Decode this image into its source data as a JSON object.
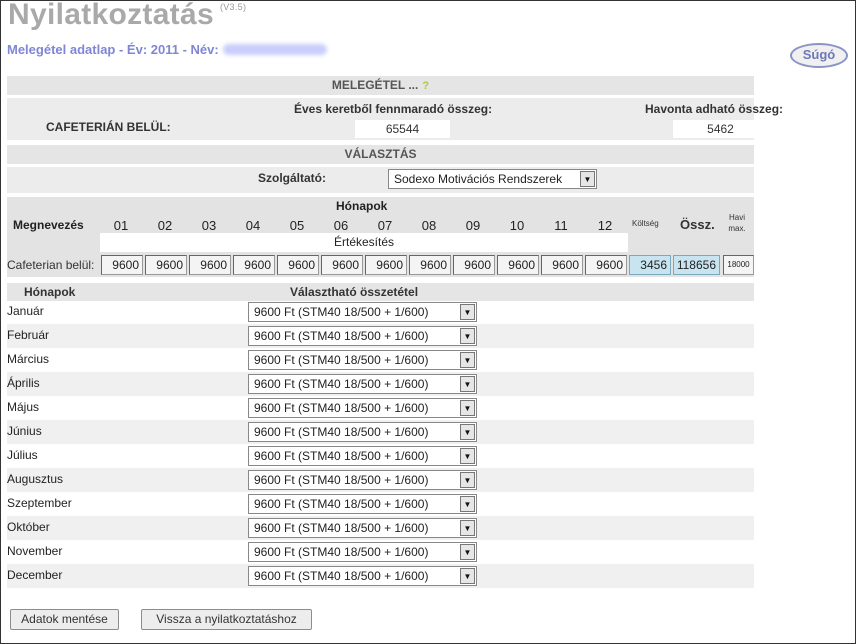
{
  "header": {
    "title": "Nyilatkoztatás",
    "version": "(V3.5)",
    "subtitle_prefix": "Melegétel adatlap - Év: 2011 - Név:",
    "help_label": "Súgó"
  },
  "section_melegetel": {
    "title": "MELEGÉTEL ...",
    "hint_icon": "question-icon"
  },
  "cafeteria": {
    "label": "CAFETERIÁN BELÜL:",
    "remaining_label": "Éves keretből fennmaradó összeg:",
    "remaining_value": "65544",
    "monthly_label": "Havonta adható összeg:",
    "monthly_value": "5462"
  },
  "section_choice": {
    "title": "VÁLASZTÁS"
  },
  "provider": {
    "label": "Szolgáltató:",
    "value": "Sodexo Motivációs Rendszerek"
  },
  "grid": {
    "megnevezes_label": "Megnevezés",
    "honapok_label": "Hónapok",
    "months": [
      "01",
      "02",
      "03",
      "04",
      "05",
      "06",
      "07",
      "08",
      "09",
      "10",
      "11",
      "12"
    ],
    "koltseg_label": "Költség",
    "ossz_label": "Össz.",
    "havi_max_label": "Havi max.",
    "ertekesites_label": "Értékesítés",
    "row_label": "Cafeterian belül:",
    "values": [
      "9600",
      "9600",
      "9600",
      "9600",
      "9600",
      "9600",
      "9600",
      "9600",
      "9600",
      "9600",
      "9600",
      "9600"
    ],
    "koltseg_value": "3456",
    "ossz_value": "118656",
    "havi_max_value": "18000"
  },
  "month_table": {
    "col_month": "Hónapok",
    "col_option": "Választható összetétel",
    "rows": [
      {
        "month": "Január",
        "option": "9600 Ft (STM40 18/500 + 1/600)"
      },
      {
        "month": "Február",
        "option": "9600 Ft (STM40 18/500 + 1/600)"
      },
      {
        "month": "Március",
        "option": "9600 Ft (STM40 18/500 + 1/600)"
      },
      {
        "month": "Április",
        "option": "9600 Ft (STM40 18/500 + 1/600)"
      },
      {
        "month": "Május",
        "option": "9600 Ft (STM40 18/500 + 1/600)"
      },
      {
        "month": "Június",
        "option": "9600 Ft (STM40 18/500 + 1/600)"
      },
      {
        "month": "Július",
        "option": "9600 Ft (STM40 18/500 + 1/600)"
      },
      {
        "month": "Augusztus",
        "option": "9600 Ft (STM40 18/500 + 1/600)"
      },
      {
        "month": "Szeptember",
        "option": "9600 Ft (STM40 18/500 + 1/600)"
      },
      {
        "month": "Október",
        "option": "9600 Ft (STM40 18/500 + 1/600)"
      },
      {
        "month": "November",
        "option": "9600 Ft (STM40 18/500 + 1/600)"
      },
      {
        "month": "December",
        "option": "9600 Ft (STM40 18/500 + 1/600)"
      }
    ]
  },
  "buttons": {
    "save": "Adatok mentése",
    "back": "Vissza a nyilatkoztatáshoz"
  }
}
